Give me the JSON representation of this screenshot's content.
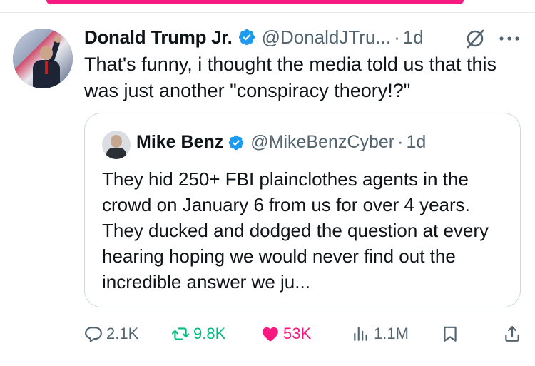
{
  "tweet": {
    "author_name": "Donald Trump Jr.",
    "author_handle": "@DonaldJTru...",
    "separator": "·",
    "time": "1d",
    "text": "That's funny, i thought the media told us that this was just another \"conspiracy theory!?\""
  },
  "quote": {
    "author_name": "Mike Benz",
    "author_handle": "@MikeBenzCyber",
    "separator": "·",
    "time": "1d",
    "text": "They hid 250+ FBI plainclothes agents in the crowd on January 6 from us for over 4 years. They ducked and dodged the question at every hearing hoping we would never find out the incredible answer we ju..."
  },
  "actions": {
    "replies": "2.1K",
    "retweets": "9.8K",
    "likes": "53K",
    "views": "1.1M"
  },
  "colors": {
    "accent": "#1d9bf0",
    "like": "#f91880",
    "retweet": "#00ba7c",
    "secondary_text": "#536471"
  },
  "icons": [
    "verified-badge-icon",
    "grok-icon",
    "more-icon",
    "reply-icon",
    "retweet-icon",
    "like-icon",
    "views-icon",
    "bookmark-icon",
    "share-icon"
  ]
}
